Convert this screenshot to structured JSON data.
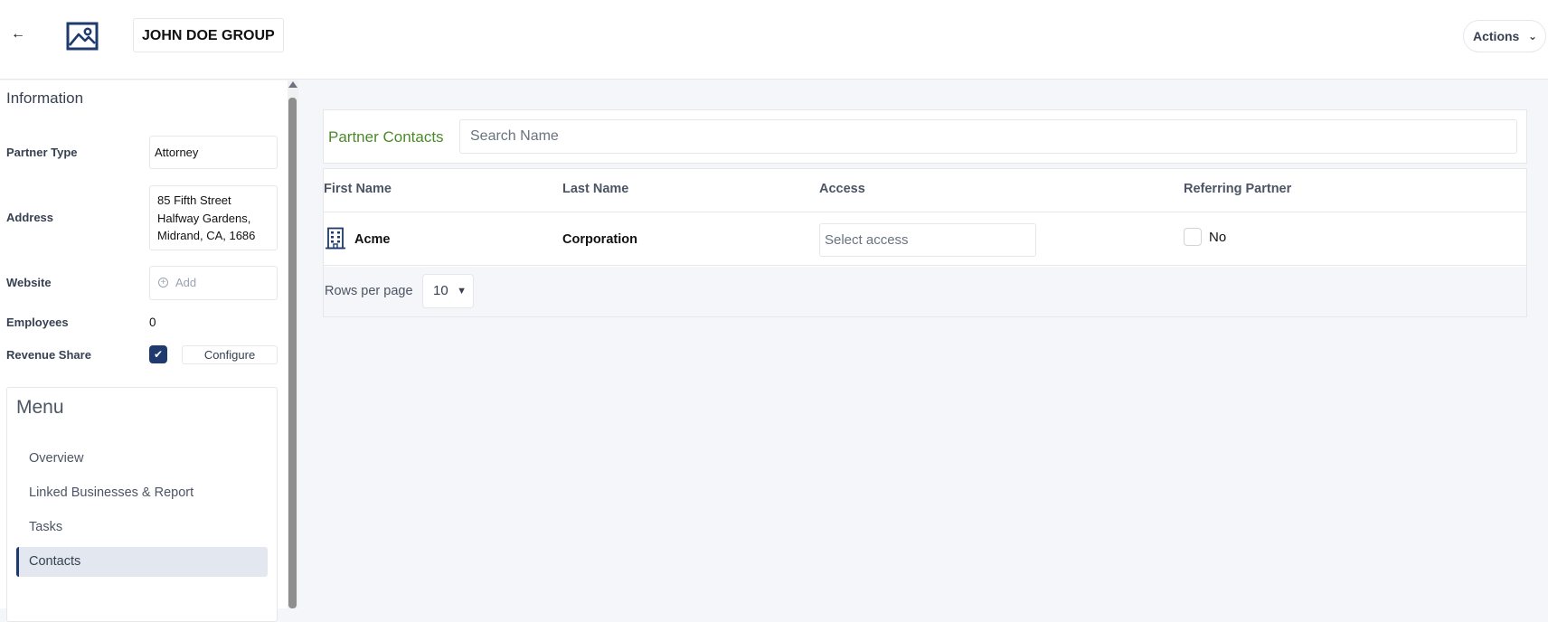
{
  "header": {
    "back_icon": "arrow-left-icon",
    "logo_icon": "image-placeholder-icon",
    "title": "JOHN DOE GROUP",
    "actions_label": "Actions",
    "actions_icon": "chevron-down-icon"
  },
  "information": {
    "title": "Information",
    "partner_type": {
      "label": "Partner Type",
      "value": "Attorney"
    },
    "address": {
      "label": "Address",
      "value": "85 Fifth Street\nHalfway Gardens,\nMidrand, CA, 1686"
    },
    "website": {
      "label": "Website",
      "placeholder": "Add"
    },
    "employees": {
      "label": "Employees",
      "value": "0"
    },
    "revenue_share": {
      "label": "Revenue Share",
      "checked": true,
      "configure_label": "Configure"
    }
  },
  "menu": {
    "title": "Menu",
    "items": [
      {
        "label": "Overview",
        "active": false
      },
      {
        "label": "Linked Businesses & Report",
        "active": false
      },
      {
        "label": "Tasks",
        "active": false
      },
      {
        "label": "Contacts",
        "active": true
      }
    ]
  },
  "contacts": {
    "title": "Partner Contacts",
    "search_placeholder": "Search Name",
    "columns": [
      "First Name",
      "Last Name",
      "Access",
      "Referring Partner"
    ],
    "rows": [
      {
        "icon": "building-icon",
        "first_name": "Acme",
        "last_name": "Corporation",
        "access_placeholder": "Select access",
        "referring_partner": "No",
        "referring_checked": false
      }
    ],
    "rows_per_page_label": "Rows per page",
    "rows_per_page_value": "10"
  },
  "colors": {
    "accent_navy": "#1e3a6e",
    "panel_title_green": "#4b8a2a",
    "background": "#f4f6f9"
  }
}
